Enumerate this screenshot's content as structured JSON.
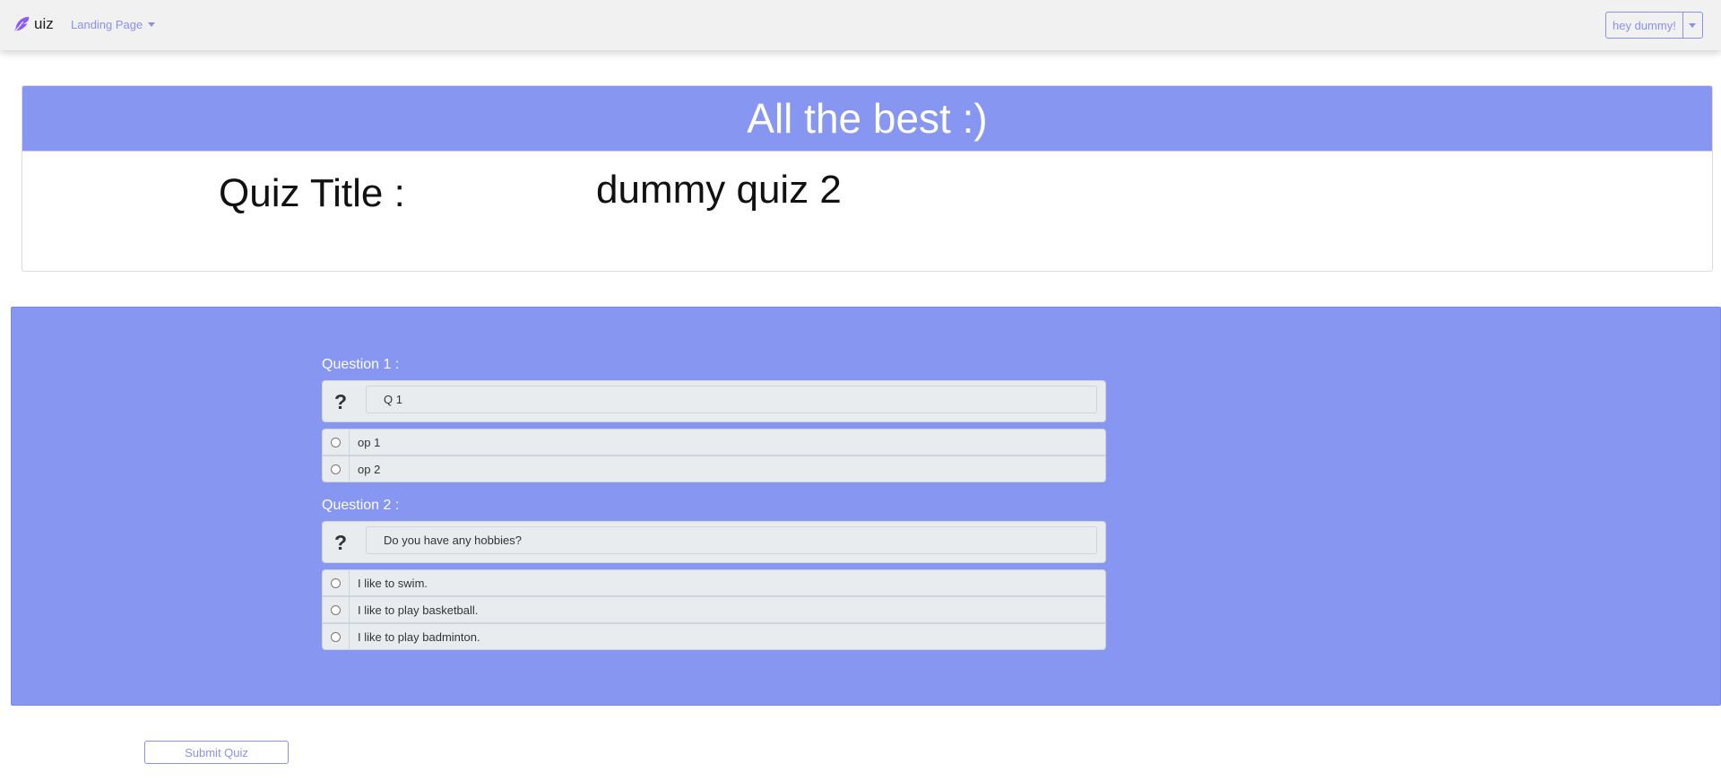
{
  "navbar": {
    "brand_text": "uiz",
    "brand_icon": "feather-icon",
    "dropdown_label": "Landing Page",
    "user_button_label": "hey dummy!"
  },
  "hero": {
    "header_text": "All the best :)",
    "quiz_title_label": "Quiz Title :",
    "quiz_title_value": "dummy quiz 2"
  },
  "questions": [
    {
      "label": "Question 1 :",
      "text": "Q 1",
      "options": [
        "op 1",
        "op 2"
      ]
    },
    {
      "label": "Question 2 :",
      "text": "Do you have any hobbies?",
      "options": [
        "I like to swim.",
        "I like to play basketball.",
        "I like to play badminton."
      ]
    }
  ],
  "submit_label": "Submit Quiz",
  "colors": {
    "accent": "#8796f1",
    "link": "#8891ef",
    "navbar_bg": "#f1f1f1"
  }
}
